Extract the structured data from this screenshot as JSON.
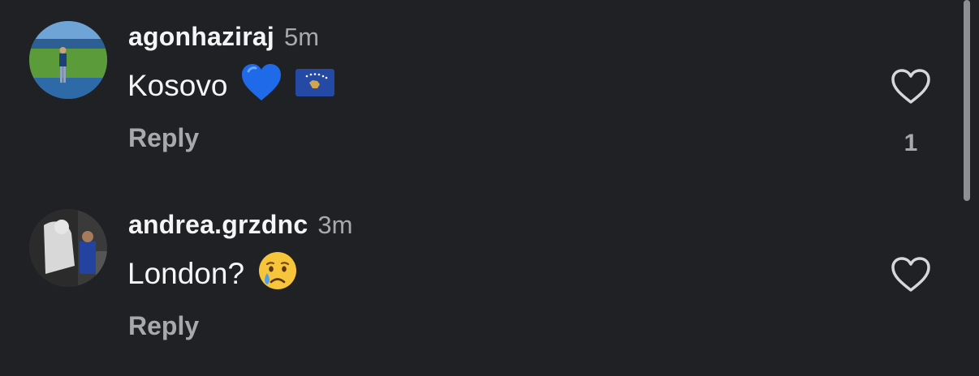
{
  "comments": [
    {
      "username": "agonhaziraj",
      "time": "5m",
      "text": "Kosovo",
      "emojis": [
        "blue-heart",
        "kosovo-flag"
      ],
      "reply_label": "Reply",
      "like_count": "1"
    },
    {
      "username": "andrea.grzdnc",
      "time": "3m",
      "text": "London?",
      "emojis": [
        "crying-face"
      ],
      "reply_label": "Reply",
      "like_count": ""
    }
  ],
  "colors": {
    "background": "#202124",
    "primary_text": "#f5f5f5",
    "secondary_text": "#a8a9ad",
    "scrollbar": "#8e8f93"
  }
}
